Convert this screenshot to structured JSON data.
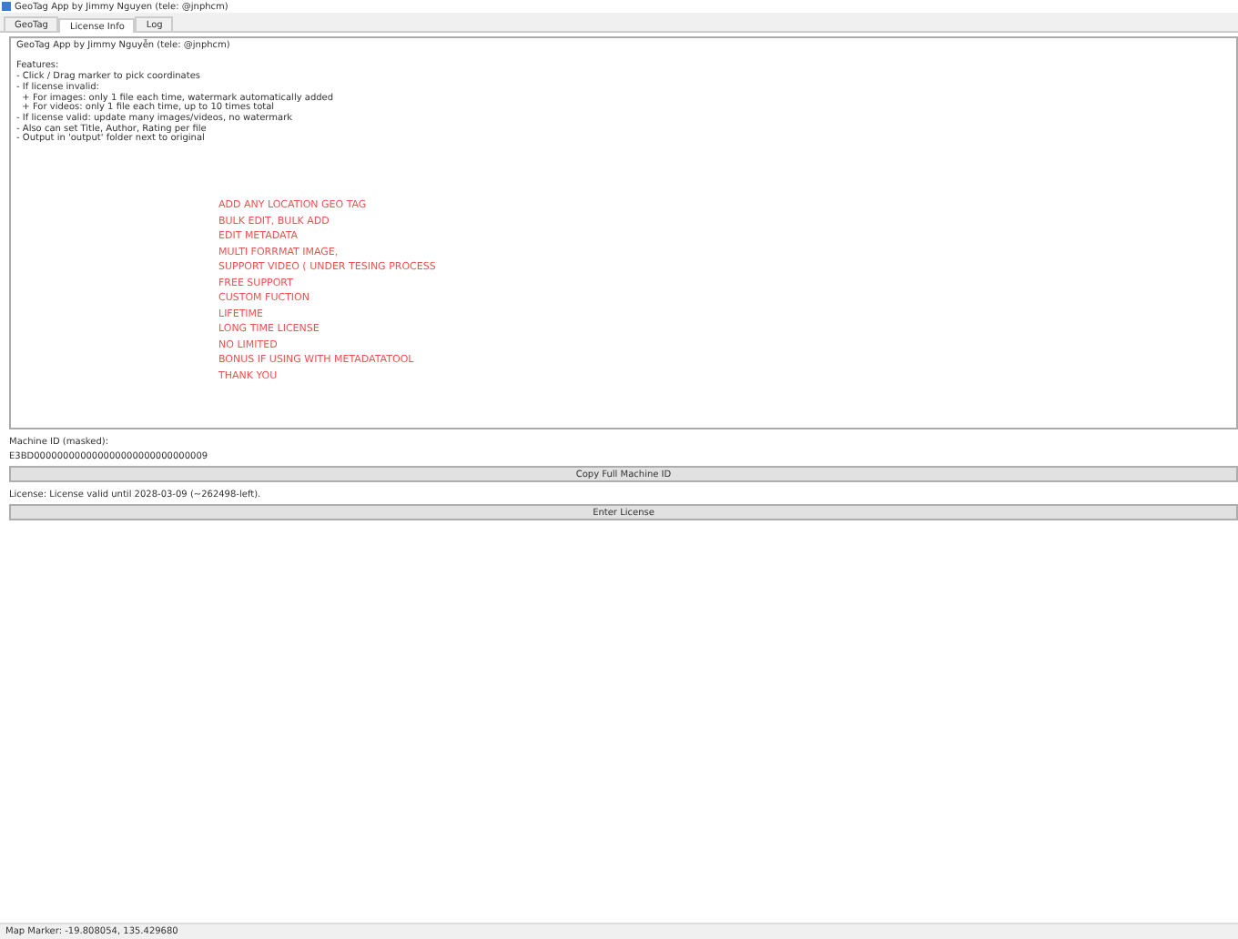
{
  "window": {
    "title": "GeoTag App by Jimmy Nguyen (tele: @jnphcm)"
  },
  "tabs": [
    {
      "label": "GeoTag",
      "selected": false
    },
    {
      "label": "License Info",
      "selected": true
    },
    {
      "label": "Log",
      "selected": false
    }
  ],
  "info_box": {
    "heading": "GeoTag App by Jimmy Nguyễn (tele: @jnphcm)",
    "lines": [
      "Features:",
      "- Click / Drag marker to pick coordinates",
      "- If license invalid:",
      "  + For images: only 1 file each time, watermark automatically added",
      "  + For videos: only 1 file each time, up to 10 times total",
      "- If license valid: update many images/videos, no watermark",
      "- Also can set Title, Author, Rating per file",
      "- Output in 'output' folder next to original"
    ],
    "promo_lines": [
      "ADD ANY LOCATION GEO TAG",
      "BULK EDIT, BULK ADD",
      "EDIT METADATA",
      "MULTI FORRMAT IMAGE,",
      "SUPPORT VIDEO ( UNDER TESING PROCESS",
      "FREE SUPPORT",
      "CUSTOM FUCTION",
      "LIFETIME",
      "LONG TIME LICENSE",
      "NO LIMITED",
      "BONUS IF USING WITH METADATATOOL",
      "THANK YOU"
    ]
  },
  "machine_label": "Machine ID (masked):",
  "machine_id": "E3BD000000000000000000000000000009",
  "copy_button": "Copy Full Machine ID",
  "license_status": "License: License valid until 2028-03-09 (~262498-left).",
  "license_button": "Enter License",
  "status_bar": "Map Marker: -19.808054, 135.429680"
}
